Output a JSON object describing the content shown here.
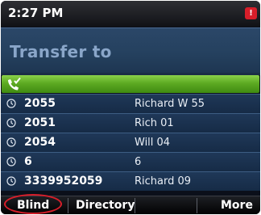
{
  "status_bar": {
    "time": "2:27 PM",
    "alert_icon": "alert-icon"
  },
  "header": {
    "title": "Transfer to"
  },
  "input": {
    "value": "",
    "icon": "phone-check-icon"
  },
  "recent_calls": [
    {
      "number": "2055",
      "name": "Richard W 55",
      "icon": "clock-icon"
    },
    {
      "number": "2051",
      "name": "Rich 01",
      "icon": "clock-icon"
    },
    {
      "number": "2054",
      "name": "Will 04",
      "icon": "clock-icon"
    },
    {
      "number": "6",
      "name": "6",
      "icon": "clock-icon"
    },
    {
      "number": "3339952059",
      "name": "Richard 09",
      "icon": "clock-icon"
    }
  ],
  "softkeys": {
    "blind": "Blind",
    "directory": "Directory",
    "more": "More"
  },
  "colors": {
    "accent_green": "#5daa22",
    "header_blue": "#25415f",
    "highlight_red": "#d81e2a"
  }
}
